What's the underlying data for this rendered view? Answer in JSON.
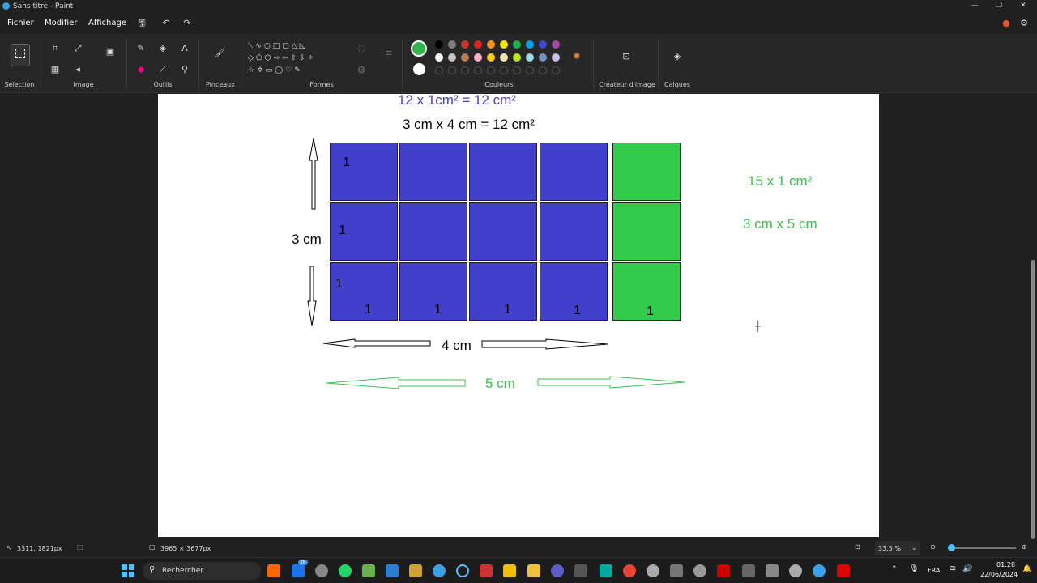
{
  "window": {
    "title": "Sans titre - Paint"
  },
  "menu": {
    "file": "Fichier",
    "edit": "Modifier",
    "view": "Affichage"
  },
  "ribbon": {
    "groups": {
      "selection": "Sélection",
      "image": "Image",
      "tools": "Outils",
      "brushes": "Pinceaux",
      "shapes": "Formes",
      "colors": "Couleurs",
      "image_creator": "Créateur d'image",
      "layers": "Calques"
    },
    "primary_color": "#33b54a",
    "secondary_color": "#ffffff",
    "palette_row1": [
      "#000000",
      "#7f7f7f",
      "#c0392b",
      "#e02424",
      "#f7941d",
      "#f5e600",
      "#22b14c",
      "#00a2e8",
      "#3f48cc",
      "#a349a4"
    ],
    "palette_row2": [
      "#ffffff",
      "#c3c3c3",
      "#b97a57",
      "#ffaec9",
      "#ffc90e",
      "#efe4b0",
      "#b5e61d",
      "#99d9ea",
      "#7092be",
      "#c8bfe7"
    ]
  },
  "canvas": {
    "top_equation": "12 x 1cm² = 12 cm²",
    "equation": "3 cm x 4 cm = 12 cm²",
    "height_label": "3 cm",
    "width_label": "4 cm",
    "green_width_label": "5 cm",
    "green_eq1": "15 x 1 cm²",
    "green_eq2": "3 cm x 5 cm",
    "one": "1"
  },
  "status": {
    "cursor_pos": "3311, 1821px",
    "canvas_size": "3965 × 3677px",
    "zoom": "33,5 %"
  },
  "taskbar": {
    "search_placeholder": "Rechercher",
    "lang": "FRA",
    "time": "01:28",
    "date": "22/06/2024",
    "badge": "36"
  },
  "colors": {
    "blue_cell": "#4040cc",
    "green_cell": "#33cc4a",
    "blue_text": "#4a3fb0",
    "green_text": "#3cbf4f"
  }
}
